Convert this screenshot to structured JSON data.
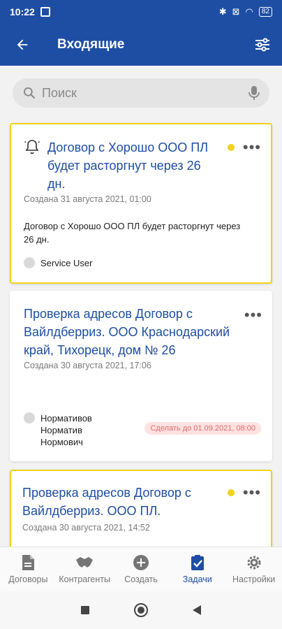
{
  "status_bar": {
    "time": "10:22",
    "battery": "82"
  },
  "app_bar": {
    "title": "Входящие"
  },
  "search": {
    "placeholder": "Поиск"
  },
  "cards": [
    {
      "title": "Договор с Хорошо ООО ПЛ будет расторгнут через 26 дн.",
      "created": "Создана 31 августа 2021, 01:00",
      "body": "Договор с Хорошо ООО ПЛ будет расторгнут через 26 дн.",
      "author": "Service User"
    },
    {
      "title": "Проверка адресов Договор с Вайлдберриз. ООО Краснодарский край, Тихорецк, дом № 26",
      "created": "Создана 30 августа 2021, 17:06",
      "author_lines": [
        "Нормативов",
        "Норматив",
        "Нормович"
      ],
      "deadline": "Сделать до 01.09.2021, 08:00"
    },
    {
      "title": "Проверка адресов Договор с Вайлдберриз. ООО ПЛ.",
      "created": "Создана 30 августа 2021, 14:52"
    }
  ],
  "bottom_nav": [
    {
      "label": "Договоры"
    },
    {
      "label": "Контрагенты"
    },
    {
      "label": "Создать"
    },
    {
      "label": "Задачи"
    },
    {
      "label": "Настройки"
    }
  ],
  "colors": {
    "primary": "#1e4ea3",
    "unread_accent": "#f2d21e",
    "deadline_bg": "#fde2e2",
    "deadline_text": "#e06a6a"
  }
}
